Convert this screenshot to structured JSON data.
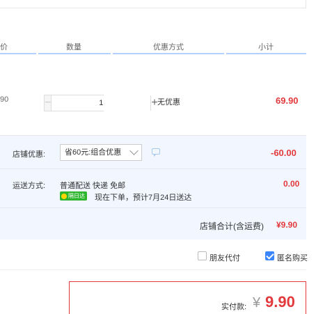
{
  "table_header": {
    "price": "价",
    "quantity": "数量",
    "discount_method": "优惠方式",
    "subtotal": "小计"
  },
  "item": {
    "price_fragment": "90",
    "quantity": "1",
    "discount": "无优惠",
    "subtotal": "69.90"
  },
  "store_discount": {
    "label": "店铺优惠:",
    "selected": "省60元:组合优惠",
    "amount": "-60.00"
  },
  "shipping": {
    "label": "运送方式:",
    "method": "普通配送 快递 免邮",
    "badge": "隔日达",
    "eta": "现在下单，预计7月24日送达",
    "amount": "0.00"
  },
  "store_total": {
    "label": "店铺合计(含运费)",
    "amount": "¥9.90"
  },
  "options": {
    "friend_pay": "朋友代付",
    "anonymous": "匿名购买",
    "anonymous_checked": true,
    "friend_pay_checked": false
  },
  "payment": {
    "label": "实付款:",
    "currency": "¥",
    "amount": "9.90"
  },
  "colors": {
    "accent_red": "#e4393c",
    "header_line": "#b2d1ff",
    "panel_bg": "#f2f7ff",
    "badge_green": "#2db52d"
  }
}
